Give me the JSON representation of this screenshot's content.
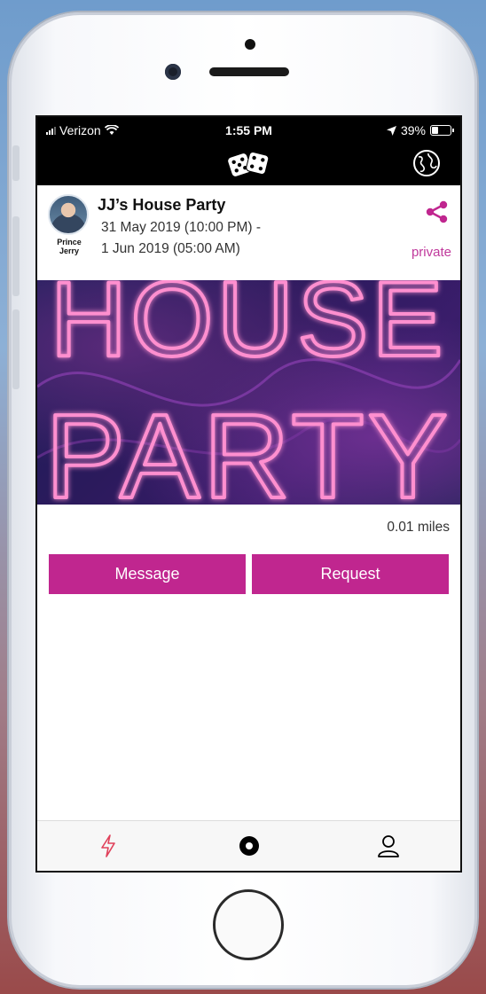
{
  "status_bar": {
    "carrier": "Verizon",
    "time": "1:55 PM",
    "battery_percent": "39%",
    "battery_level": 0.39,
    "icons": [
      "signal-bars-icon",
      "wifi-icon",
      "location-arrow-icon",
      "battery-icon"
    ]
  },
  "nav_bar": {
    "logo_icon": "dice-icon",
    "right_icon": "globe-icon"
  },
  "event": {
    "host_name": "Prince Jerry",
    "title": "JJ’s House Party",
    "date_start": "31 May 2019 (10:00 PM) -",
    "date_end": "1 Jun 2019 (05:00 AM)",
    "privacy": "private",
    "distance": "0.01 miles",
    "image_text": [
      "HOUSE",
      "PARTY"
    ]
  },
  "actions": {
    "message_label": "Message",
    "request_label": "Request"
  },
  "tab_bar": {
    "tabs": [
      "bolt-icon",
      "record-icon",
      "profile-icon"
    ]
  },
  "colors": {
    "accent": "#c0268f",
    "privacy_text": "#c0399c",
    "bolt": "#e0405a"
  }
}
